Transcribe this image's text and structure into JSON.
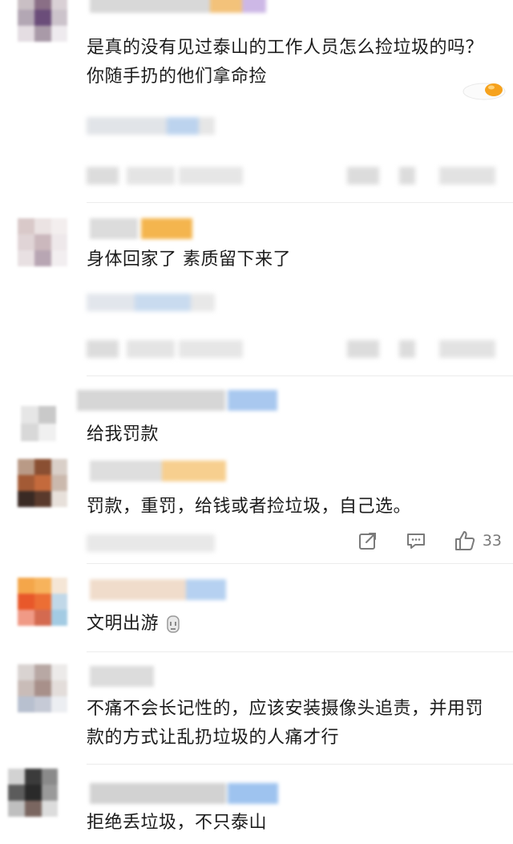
{
  "comments": [
    {
      "text": "是真的没有见过泰山的工作人员怎么捡垃圾的吗？你随手扔的他们拿命捡"
    },
    {
      "text": "身体回家了 素质留下来了"
    },
    {
      "text": "给我罚款"
    },
    {
      "text": "罚款，重罚，给钱或者捡垃圾，自己选。",
      "likes": "33"
    },
    {
      "text": "文明出游"
    },
    {
      "text": "不痛不会长记性的，应该安装摄像头追责，并用罚款的方式让乱扔垃圾的人痛才行"
    },
    {
      "text": "拒绝丢垃圾，不只泰山"
    }
  ],
  "icons": {
    "share": "share-icon",
    "comment": "comment-icon",
    "like": "like-icon",
    "egg_sticker": "fried-egg-sticker",
    "inline_emoji": "speechless-emoji-icon"
  },
  "colors": {
    "text": "#1c1c1c",
    "meta": "#7a7a7a",
    "accent_orange": "#f5a623",
    "accent_blue": "#7fb2ee"
  }
}
